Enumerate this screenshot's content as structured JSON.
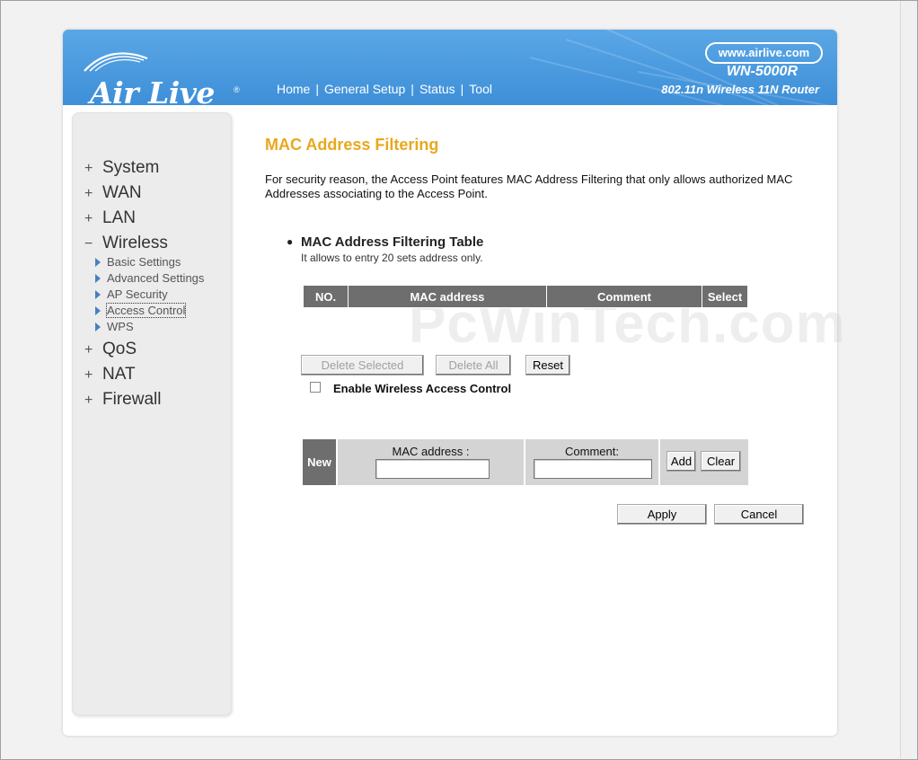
{
  "header": {
    "brand": "Air Live",
    "nav": [
      "Home",
      "General Setup",
      "Status",
      "Tool"
    ],
    "url": "www.airlive.com",
    "model": "WN-5000R",
    "model_desc": "802.11n Wireless 11N Router"
  },
  "sidebar": {
    "items": [
      {
        "label": "System",
        "sign": "+"
      },
      {
        "label": "WAN",
        "sign": "+"
      },
      {
        "label": "LAN",
        "sign": "+"
      },
      {
        "label": "Wireless",
        "sign": "−"
      },
      {
        "label": "QoS",
        "sign": "+"
      },
      {
        "label": "NAT",
        "sign": "+"
      },
      {
        "label": "Firewall",
        "sign": "+"
      }
    ],
    "wireless_sub": [
      "Basic Settings",
      "Advanced Settings",
      "AP Security",
      "Access Control",
      "WPS"
    ],
    "active_sub": "Access Control"
  },
  "main": {
    "title": "MAC Address Filtering",
    "description": "For security reason, the Access Point features MAC Address Filtering that only allows authorized MAC Addresses associating to the Access Point.",
    "watermark": "PcWinTech.com",
    "table_title": "MAC Address Filtering Table",
    "table_note": "It allows to entry 20 sets address only.",
    "columns": [
      "NO.",
      "MAC address",
      "Comment",
      "Select"
    ],
    "buttons": {
      "delete_selected": "Delete Selected",
      "delete_all": "Delete All",
      "reset": "Reset",
      "add": "Add",
      "clear": "Clear",
      "apply": "Apply",
      "cancel": "Cancel"
    },
    "enable_label": "Enable Wireless Access Control",
    "enable_checked": false,
    "new_row": {
      "new_label": "New",
      "mac_label": "MAC address :",
      "mac_value": "",
      "comment_label": "Comment:",
      "comment_value": ""
    }
  }
}
